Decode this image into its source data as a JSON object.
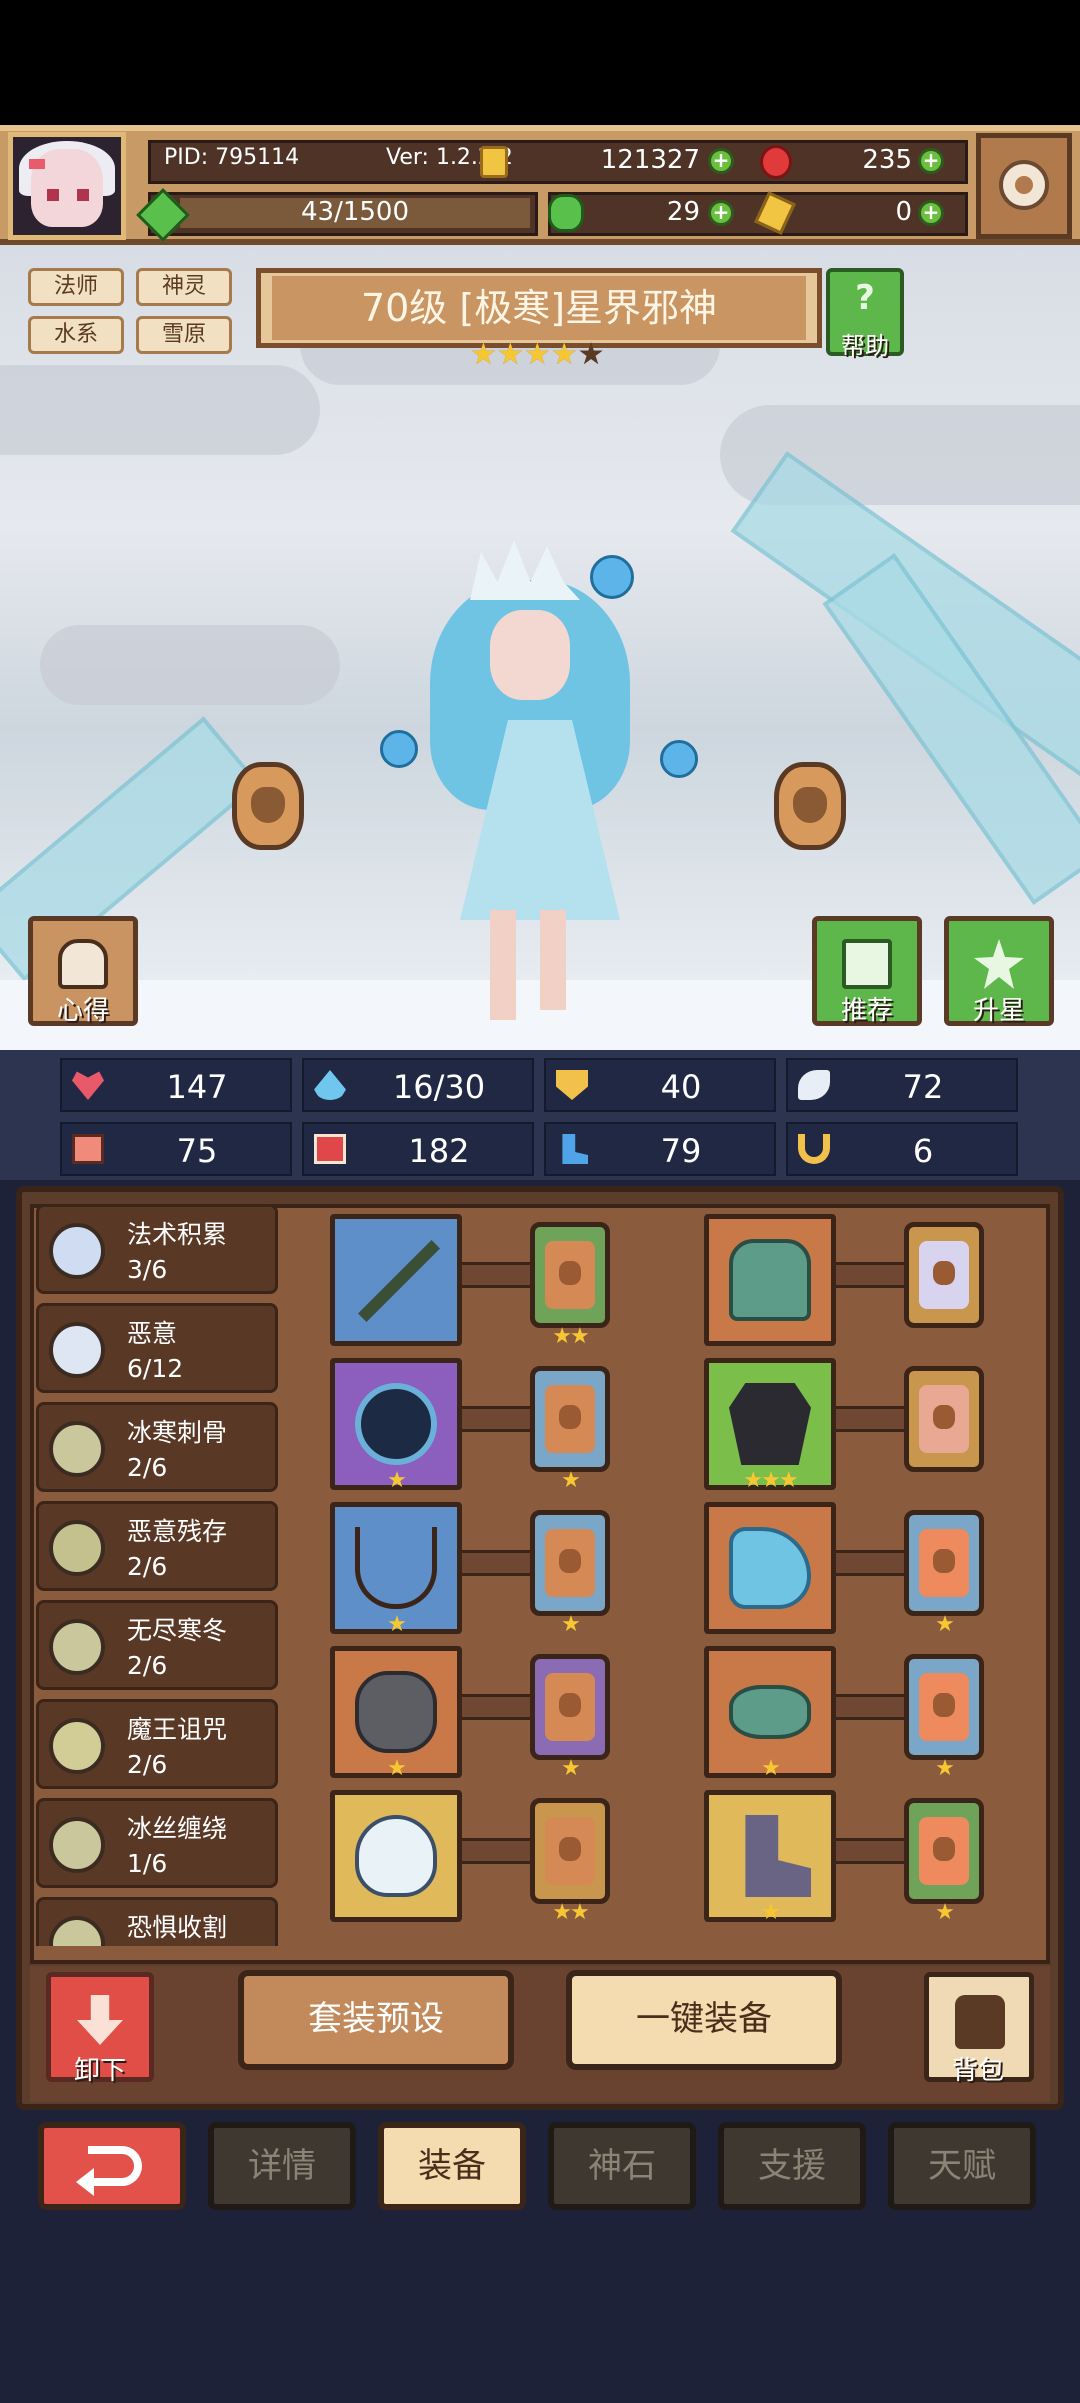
{
  "header": {
    "pid": "PID: 795114",
    "version": "Ver: 1.2.2.2",
    "gold": "121327",
    "gems": "235",
    "exp": "43/1500",
    "clover": "29",
    "key": "0"
  },
  "tags": [
    "法师",
    "神灵",
    "水系",
    "雪原"
  ],
  "title": "70级 [极寒]星界邪神",
  "star_rating": {
    "filled": 4,
    "total": 5
  },
  "help_label": "帮助",
  "side_buttons": {
    "insight": "心得",
    "recommend": "推荐",
    "upgrade_star": "升星"
  },
  "stats": [
    {
      "icon": "heart-icon",
      "value": "147",
      "color": "#e85a6a"
    },
    {
      "icon": "water-drop-icon",
      "value": "16/30",
      "color": "#6fc7f0"
    },
    {
      "icon": "shield-icon",
      "value": "40",
      "color": "#f2c14b"
    },
    {
      "icon": "wing-icon",
      "value": "72",
      "color": "#e8eef5"
    },
    {
      "icon": "fist-icon",
      "value": "75",
      "color": "#f08a7a"
    },
    {
      "icon": "spellbook-icon",
      "value": "182",
      "color": "#e0474a"
    },
    {
      "icon": "boot-icon",
      "value": "79",
      "color": "#4fa3e8"
    },
    {
      "icon": "horseshoe-icon",
      "value": "6",
      "color": "#f2c14b"
    }
  ],
  "sets": [
    {
      "name": "法术积累",
      "count": "3/6",
      "color": "#cfdcf2"
    },
    {
      "name": "恶意",
      "count": "6/12",
      "color": "#dfe6f3"
    },
    {
      "name": "冰寒刺骨",
      "count": "2/6",
      "color": "#c9c79b"
    },
    {
      "name": "恶意残存",
      "count": "2/6",
      "color": "#c4c18e"
    },
    {
      "name": "无尽寒冬",
      "count": "2/6",
      "color": "#c9c79b"
    },
    {
      "name": "魔王诅咒",
      "count": "2/6",
      "color": "#d2cc97"
    },
    {
      "name": "冰丝缠绕",
      "count": "1/6",
      "color": "#c9c79b"
    },
    {
      "name": "恐惧收割",
      "count": "",
      "color": "#c9c79b"
    }
  ],
  "equipment": {
    "left": [
      {
        "item": "ice-spear-icon",
        "bg": "#5f8fc8",
        "stars": "",
        "rune_stars": "★★",
        "rune_border": "#6fa35a"
      },
      {
        "item": "dark-orb-icon",
        "bg": "#8c5fbf",
        "stars": "★",
        "rune_stars": "★",
        "rune_border": "#7aa6c7"
      },
      {
        "item": "frost-amulet-icon",
        "bg": "#5f8fc8",
        "stars": "★",
        "rune_stars": "★",
        "rune_border": "#7aa6c7"
      },
      {
        "item": "stone-gauntlet-icon",
        "bg": "#c97848",
        "stars": "★",
        "rune_stars": "★",
        "rune_border": "#8c6bb5"
      },
      {
        "item": "ice-helm-icon",
        "bg": "#e0b95a",
        "stars": "",
        "rune_stars": "★★",
        "rune_border": "#c8964c"
      }
    ],
    "right": [
      {
        "item": "jade-armor-icon",
        "bg": "#c97848",
        "stars": "",
        "rune_stars": "",
        "rune_border": "#c8964c"
      },
      {
        "item": "shadow-cloak-icon",
        "bg": "#7bbf4a",
        "stars": "★★★",
        "rune_stars": "",
        "rune_border": "#c8964c"
      },
      {
        "item": "frost-glove-icon",
        "bg": "#c97848",
        "stars": "",
        "rune_stars": "★",
        "rune_border": "#7aa6c7"
      },
      {
        "item": "jade-mask-icon",
        "bg": "#c97848",
        "stars": "★",
        "rune_stars": "★",
        "rune_border": "#7aa6c7"
      },
      {
        "item": "violet-boots-icon",
        "bg": "#e0b95a",
        "stars": "★",
        "rune_stars": "★",
        "rune_border": "#6fa35a"
      }
    ]
  },
  "actions": {
    "unload": "卸下",
    "preset": "套装预设",
    "equip_all": "一键装备",
    "bag": "背包"
  },
  "tabs": [
    "详情",
    "装备",
    "神石",
    "支援",
    "天赋"
  ],
  "active_tab": "装备"
}
